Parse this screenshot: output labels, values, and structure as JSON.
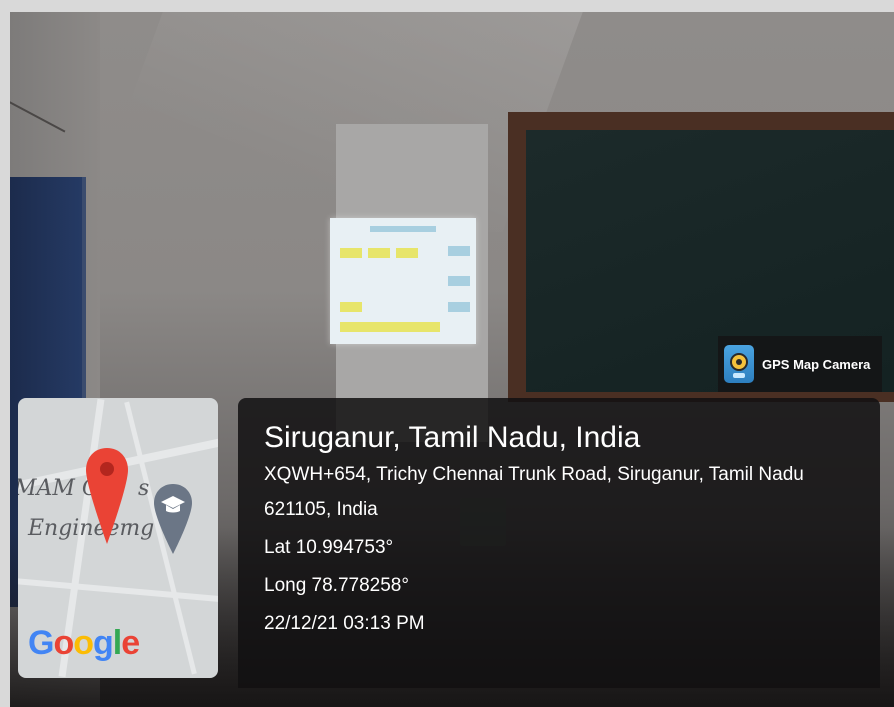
{
  "watermark": {
    "app_name": "GPS Map Camera",
    "map_logo": "Google",
    "map_place_text": [
      "MAM Co",
      "s",
      "Engineer",
      "ng"
    ],
    "icons": [
      "location-pin-icon",
      "graduation-cap-icon",
      "camera-app-icon"
    ]
  },
  "location": {
    "title": "Siruganur, Tamil Nadu, India",
    "address_line1": "XQWH+654, Trichy Chennai Trunk Road, Siruganur, Tamil Nadu",
    "address_line2": "621105, India",
    "lat": "Lat 10.994753°",
    "long": "Long 78.778258°",
    "datetime": "22/12/21 03:13 PM"
  },
  "colors": {
    "pin_red": "#ea4335",
    "marker_gray": "#6b7686",
    "panel_bg": "#121012"
  }
}
